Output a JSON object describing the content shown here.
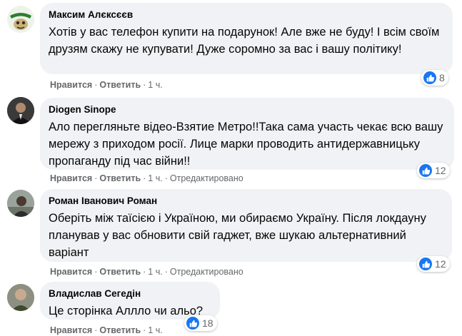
{
  "comments": [
    {
      "author": "Максим Алєксєєв",
      "text": "Хотів у вас телефон купити на подарунок! Але вже не буду! І всім своїм друзям скажу не купувати! Дуже соромно за вас і вашу політику!",
      "like": "Нравится",
      "reply": "Ответить",
      "time": "1 ч.",
      "edited": "",
      "reactions": "8",
      "avatar": "ukraine-logo-avatar"
    },
    {
      "author": "Diogen Sinope",
      "text": "Ало перегляньте відео-Взятие Метро!!Така сама участь чекає всю вашу мережу з приходом росії. Лице марки проводить антидержавницьку пропаганду під час війни!!",
      "like": "Нравится",
      "reply": "Ответить",
      "time": "1 ч.",
      "edited": "Отредактировано",
      "reactions": "12",
      "avatar": "man-in-suit-avatar"
    },
    {
      "author": "Роман Іванович Роман",
      "text": "Оберіть між таїсією і Україною, ми обираємо Україну. Після локдауну планував у вас обновити свій гаджет, вже шукаю альтернативний варіант",
      "like": "Нравится",
      "reply": "Ответить",
      "time": "1 ч.",
      "edited": "Отредактировано",
      "reactions": "12",
      "avatar": "man-outdoor-avatar"
    },
    {
      "author": "Владислав Сегедін",
      "text": "Це сторінка Аллло чи альо?",
      "like": "Нравится",
      "reply": "Ответить",
      "time": "1 ч.",
      "edited": "",
      "reactions": "18",
      "avatar": "bald-man-avatar"
    }
  ],
  "colors": {
    "bubble": "#f0f2f5",
    "like_badge": "#1877f2",
    "meta": "#65676b"
  }
}
